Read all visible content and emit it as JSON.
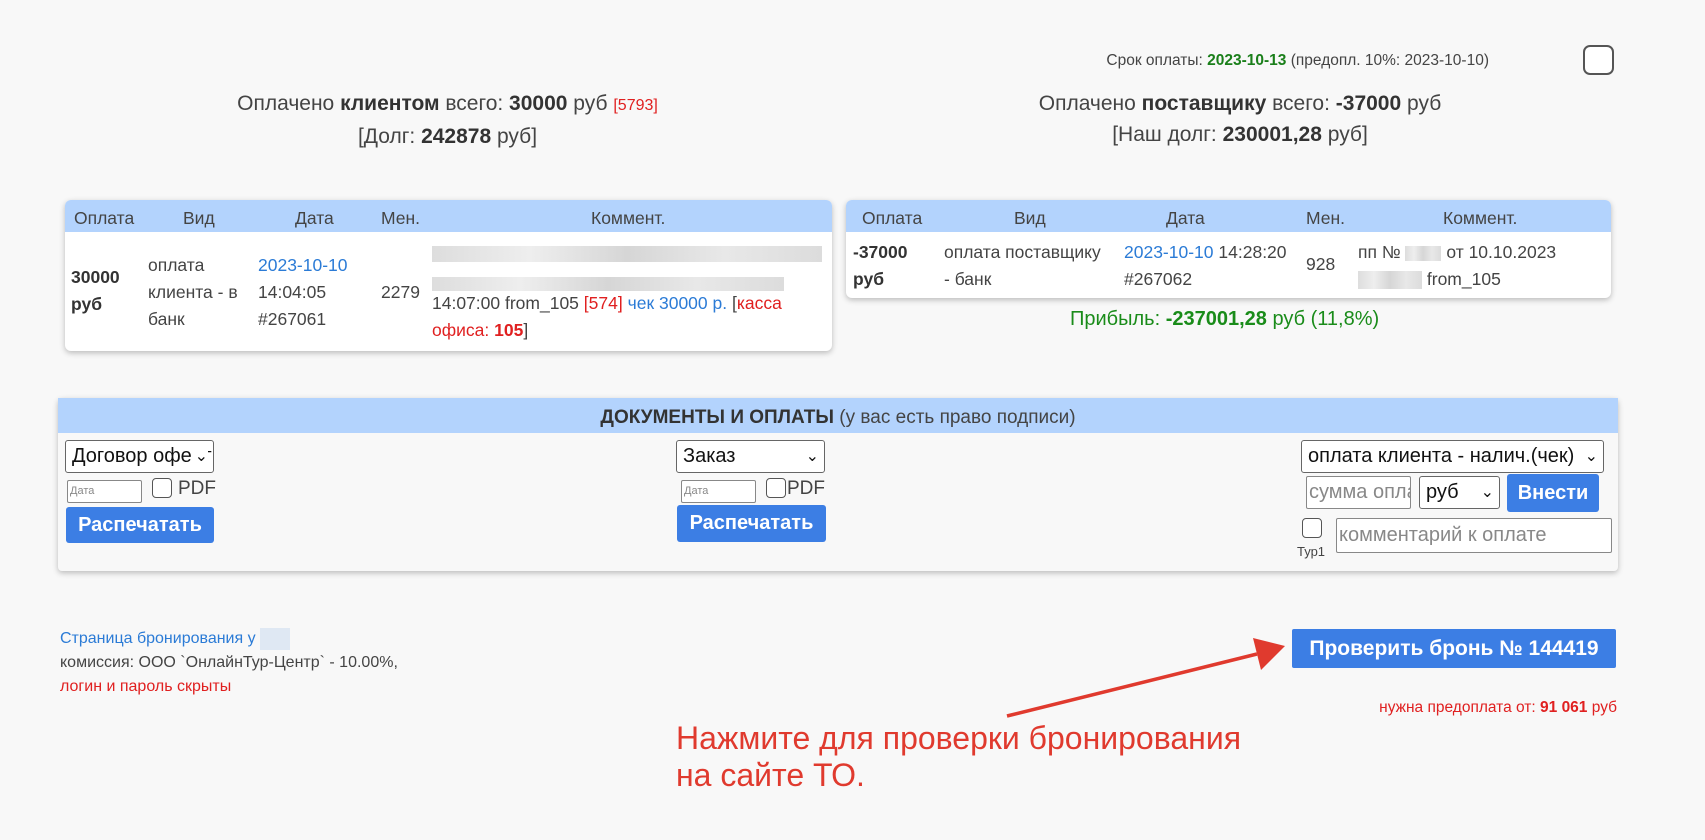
{
  "deadline": {
    "label": "Срок оплаты:",
    "date": "2023-10-13",
    "prepay_note": "(предопл. 10%: 2023-10-10)"
  },
  "client_summary": {
    "paid_prefix": "Оплачено",
    "paid_bold": "клиентом",
    "paid_mid": "всего:",
    "paid_amount": "30000",
    "currency": "руб",
    "paid_ref": "[5793]",
    "debt_prefix": "[Долг:",
    "debt_amount": "242878",
    "debt_suffix": "руб]"
  },
  "supplier_summary": {
    "paid_prefix": "Оплачено",
    "paid_bold": "поставщику",
    "paid_mid": "всего:",
    "paid_amount": "-37000",
    "currency": "руб",
    "debt_prefix": "[Наш долг:",
    "debt_amount": "230001,28",
    "debt_suffix": "руб]"
  },
  "table_headers": {
    "pay": "Оплата",
    "kind": "Вид",
    "date": "Дата",
    "manager": "Мен.",
    "comment": "Коммент."
  },
  "client_payment": {
    "amount_l1": "30000",
    "amount_l2": "руб",
    "kind": [
      "оплата",
      "клиента - в",
      "банк"
    ],
    "date": "2023-10-10",
    "time": "14:04:05",
    "id": "#267061",
    "manager": "2279",
    "comment_time": "14:07:00 from_105",
    "comment_ref": "[574]",
    "comment_check": "чек 30000 р.",
    "comment_kassa_open": "[",
    "comment_kassa": "касса офиса:",
    "comment_kassa_num": "105",
    "comment_kassa_close": "]"
  },
  "supplier_payment": {
    "amount_l1": "-37000",
    "amount_l2": "руб",
    "kind": [
      "оплата поставщику",
      "- банк"
    ],
    "date": "2023-10-10",
    "time": "14:28:20",
    "id": "#267062",
    "manager": "928",
    "comment_l1_a": "пп №",
    "comment_l1_b": "от 10.10.2023",
    "comment_l2": "from_105"
  },
  "profit": {
    "label": "Прибыль:",
    "amount": "-237001,28",
    "suffix": "руб (11,8%)"
  },
  "docs": {
    "title": "ДОКУМЕНТЫ И ОПЛАТЫ",
    "subtitle": "(у вас есть право подписи)",
    "doc1_select": "Договор оферты",
    "doc2_select": "Заказ",
    "date_placeholder": "Дата",
    "pdf_label": "PDF",
    "print_label": "Распечатать",
    "pay_type_select": "оплата клиента - налич.(чек)",
    "sum_placeholder": "сумма оплаты",
    "currency_select": "руб",
    "submit_label": "Внести",
    "tur_label": "Тур1",
    "comment_placeholder": "комментарий к оплате"
  },
  "booking": {
    "link_text": "Страница бронирования у",
    "commission": "комиссия: ООО `ОнлайнТур-Центр` - 10.00%,",
    "login_hidden": "логин и пароль скрыты",
    "check_button": "Проверить бронь № 144419",
    "prepay_label": "нужна предоплата от:",
    "prepay_amount": "91 061",
    "prepay_currency": "руб"
  },
  "hint": {
    "line1": "Нажмите для проверки бронирования",
    "line2": "на сайте ТО."
  },
  "colors": {
    "header_blue": "#b3d3fd",
    "button_blue": "#3c7ee4",
    "link_blue": "#2b7bd6",
    "accent_red": "#e02020",
    "profit_green": "#1a8c1a",
    "arrow_red": "#e03a2e"
  }
}
